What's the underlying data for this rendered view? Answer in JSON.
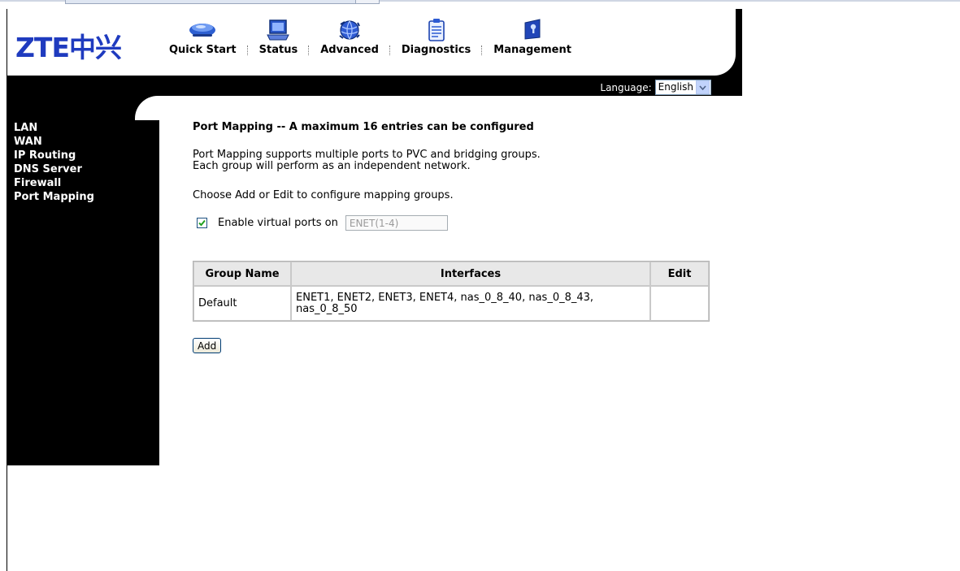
{
  "brand": {
    "logo_text": "ZTE中兴",
    "logo_color": "#1f3bbf"
  },
  "nav": [
    {
      "label": "Quick Start",
      "icon": "router-icon"
    },
    {
      "label": "Status",
      "icon": "laptop-icon"
    },
    {
      "label": "Advanced",
      "icon": "globe-icon"
    },
    {
      "label": "Diagnostics",
      "icon": "clipboard-icon"
    },
    {
      "label": "Management",
      "icon": "key-icon"
    }
  ],
  "language": {
    "label": "Language:",
    "value": "English"
  },
  "sidebar": {
    "items": [
      "LAN",
      "WAN",
      "IP Routing",
      "DNS Server",
      "Firewall",
      "Port Mapping"
    ]
  },
  "page": {
    "title": "Port Mapping -- A maximum 16 entries can be configured",
    "desc_line1": "Port Mapping supports multiple ports to PVC and bridging groups.",
    "desc_line2": "Each group will perform as an independent network.",
    "instruction": "Choose Add or Edit to configure mapping groups.",
    "virtual_ports": {
      "label": "Enable virtual ports on",
      "value": "ENET(1-4)",
      "checked": true
    }
  },
  "table": {
    "headers": [
      "Group Name",
      "Interfaces",
      "Edit"
    ],
    "rows": [
      {
        "group": "Default",
        "interfaces_line1": "ENET1, ENET2, ENET3, ENET4, nas_0_8_40, nas_0_8_43,",
        "interfaces_line2": "nas_0_8_50",
        "edit": ""
      }
    ]
  },
  "buttons": {
    "add": "Add"
  }
}
